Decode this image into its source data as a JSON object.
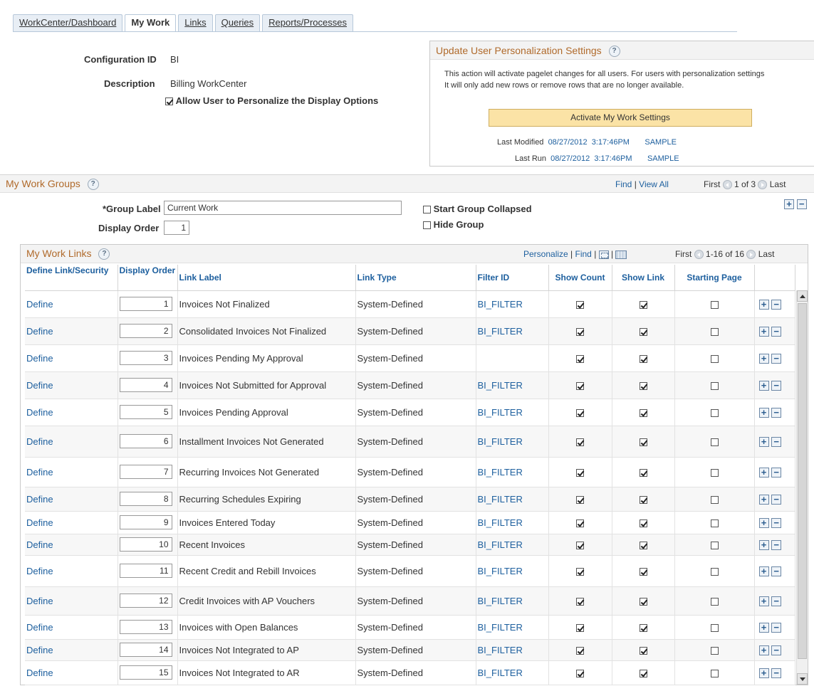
{
  "tabs": [
    {
      "label": "WorkCenter/Dashboard"
    },
    {
      "label": "My Work",
      "active": true
    },
    {
      "label": "Links"
    },
    {
      "label": "Queries"
    },
    {
      "label": "Reports/Processes"
    }
  ],
  "config": {
    "id_label": "Configuration ID",
    "id_value": "BI",
    "desc_label": "Description",
    "desc_value": "Billing WorkCenter",
    "allow_label": "Allow User to Personalize the Display Options",
    "allow_checked": true
  },
  "update_panel": {
    "title": "Update User Personalization Settings",
    "text1": "This action will activate pagelet changes for all users.  For users with personalization settings",
    "text2": "It will only add new rows or remove rows that are no longer available.",
    "button": "Activate My Work Settings",
    "last_modified_label": "Last Modified",
    "last_modified_date": "08/27/2012",
    "last_modified_time": "3:17:46PM",
    "last_modified_user": "SAMPLE",
    "last_run_label": "Last Run",
    "last_run_date": "08/27/2012",
    "last_run_time": "3:17:46PM",
    "last_run_user": "SAMPLE"
  },
  "groups": {
    "title": "My Work Groups",
    "find": "Find",
    "sep": "|",
    "view_all": "View All",
    "first": "First",
    "range": "1 of 3",
    "last": "Last",
    "group_label_label": "*Group Label",
    "group_label_value": "Current Work",
    "display_order_label": "Display Order",
    "display_order_value": "1",
    "start_collapsed_label": "Start Group Collapsed",
    "hide_group_label": "Hide Group"
  },
  "links": {
    "title": "My Work Links",
    "personalize": "Personalize",
    "sep": "|",
    "find": "Find",
    "first": "First",
    "range": "1-16 of 16",
    "last": "Last",
    "headers": [
      "Define Link/Security",
      "Display Order",
      "Link Label",
      "Link Type",
      "Filter ID",
      "Show Count",
      "Show Link",
      "Starting Page"
    ],
    "define_text": "Define",
    "rows": [
      {
        "order": "1",
        "label": "Invoices Not Finalized",
        "type": "System-Defined",
        "filter": "BI_FILTER",
        "count": true,
        "link": true,
        "start": false
      },
      {
        "order": "2",
        "label": "Consolidated Invoices Not Finalized",
        "type": "System-Defined",
        "filter": "BI_FILTER",
        "count": true,
        "link": true,
        "start": false
      },
      {
        "order": "3",
        "label": "Invoices Pending My Approval",
        "type": "System-Defined",
        "filter": "",
        "count": true,
        "link": true,
        "start": false
      },
      {
        "order": "4",
        "label": "Invoices Not Submitted for Approval",
        "type": "System-Defined",
        "filter": "BI_FILTER",
        "count": true,
        "link": true,
        "start": false
      },
      {
        "order": "5",
        "label": "Invoices Pending Approval",
        "type": "System-Defined",
        "filter": "BI_FILTER",
        "count": true,
        "link": true,
        "start": false
      },
      {
        "order": "6",
        "label": "Installment Invoices Not Generated",
        "type": "System-Defined",
        "filter": "BI_FILTER",
        "count": true,
        "link": true,
        "start": false
      },
      {
        "order": "7",
        "label": "Recurring Invoices Not Generated",
        "type": "System-Defined",
        "filter": "BI_FILTER",
        "count": true,
        "link": true,
        "start": false
      },
      {
        "order": "8",
        "label": "Recurring Schedules Expiring",
        "type": "System-Defined",
        "filter": "BI_FILTER",
        "count": true,
        "link": true,
        "start": false
      },
      {
        "order": "9",
        "label": "Invoices Entered Today",
        "type": "System-Defined",
        "filter": "BI_FILTER",
        "count": true,
        "link": true,
        "start": false
      },
      {
        "order": "10",
        "label": "Recent Invoices",
        "type": "System-Defined",
        "filter": "BI_FILTER",
        "count": true,
        "link": true,
        "start": false
      },
      {
        "order": "11",
        "label": "Recent Credit and Rebill Invoices",
        "type": "System-Defined",
        "filter": "BI_FILTER",
        "count": true,
        "link": true,
        "start": false
      },
      {
        "order": "12",
        "label": "Credit Invoices with AP Vouchers",
        "type": "System-Defined",
        "filter": "BI_FILTER",
        "count": true,
        "link": true,
        "start": false
      },
      {
        "order": "13",
        "label": "Invoices with Open Balances",
        "type": "System-Defined",
        "filter": "BI_FILTER",
        "count": true,
        "link": true,
        "start": false
      },
      {
        "order": "14",
        "label": "Invoices Not Integrated to AP",
        "type": "System-Defined",
        "filter": "BI_FILTER",
        "count": true,
        "link": true,
        "start": false
      },
      {
        "order": "15",
        "label": "Invoices Not Integrated to AR",
        "type": "System-Defined",
        "filter": "BI_FILTER",
        "count": true,
        "link": true,
        "start": false
      }
    ]
  }
}
